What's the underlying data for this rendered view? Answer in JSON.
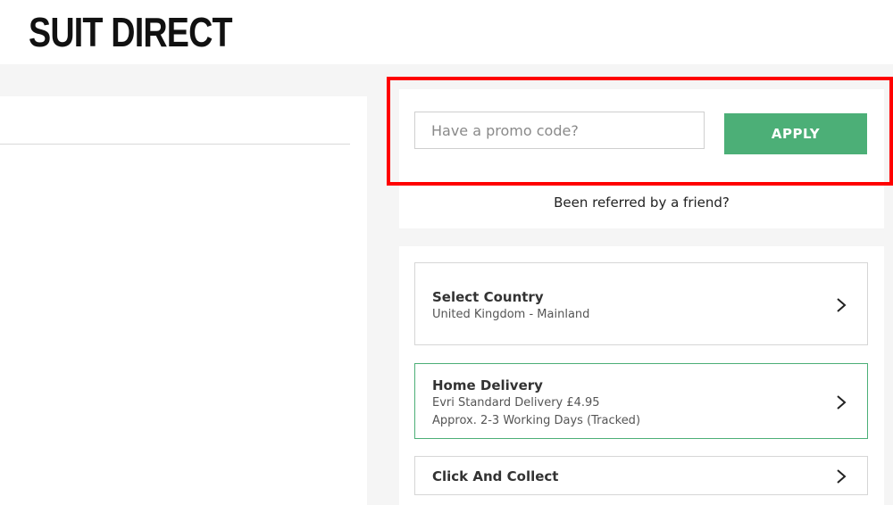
{
  "header": {
    "logo_text": "SUIT DIRECT"
  },
  "promo": {
    "placeholder": "Have a promo code?",
    "apply_label": "APPLY",
    "referred_text": "Been referred by a friend?"
  },
  "delivery": {
    "options": [
      {
        "title": "Select Country",
        "lines": [
          "United Kingdom - Mainland"
        ],
        "icon": "chevron-right-icon"
      },
      {
        "title": "Home Delivery",
        "lines": [
          "Evri Standard Delivery £4.95",
          "Approx. 2-3 Working Days (Tracked)"
        ],
        "selected": true,
        "icon": "chevron-right-icon"
      },
      {
        "title": "Click And Collect",
        "lines": [],
        "icon": "chevron-right-icon"
      }
    ]
  },
  "colors": {
    "accent": "#4caf77",
    "highlight": "#ff0000"
  }
}
